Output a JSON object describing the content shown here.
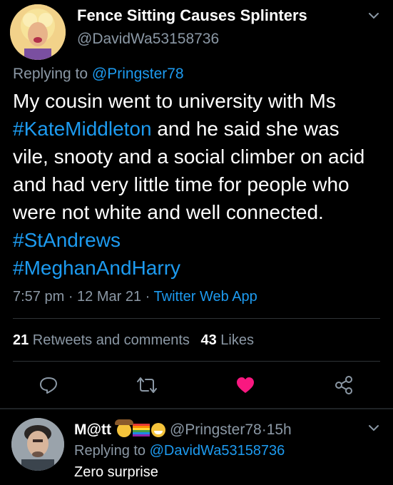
{
  "tweet": {
    "author_name": "Fence Sitting Causes Splinters",
    "author_handle": "@DavidWa53158736",
    "replying_prefix": "Replying to ",
    "replying_handle": "@Pringster78",
    "text": {
      "seg1": "My cousin went to university with Ms ",
      "tag1": "#KateMiddleton",
      "seg2": " and he said she was vile, snooty and a social climber on acid and had very little time for people who were not white and well connected. ",
      "tag2": "#StAndrews",
      "tag3": "#MeghanAndHarry"
    },
    "time": "7:57 pm",
    "sep1": " · ",
    "date": "12 Mar 21",
    "sep2": " · ",
    "source": "Twitter Web App",
    "retweets_count": "21",
    "retweets_label": " Retweets and comments",
    "likes_count": "43",
    "likes_label": " Likes"
  },
  "actions": {
    "liked": true,
    "like_color": "#f91880"
  },
  "reply": {
    "author_name": "M@tt",
    "emoji_icons": [
      "cowboy-emoji-icon",
      "rainbow-flag-icon",
      "grinning-emoji-icon"
    ],
    "handle": "@Pringster78",
    "sep": " · ",
    "age": "15h",
    "replying_prefix": "Replying to ",
    "replying_handle": "@DavidWa53158736",
    "text": "Zero surprise"
  },
  "colors": {
    "background": "#000000",
    "accent": "#1d9bf0",
    "muted": "#8b98a5",
    "divider": "#2f3336"
  }
}
